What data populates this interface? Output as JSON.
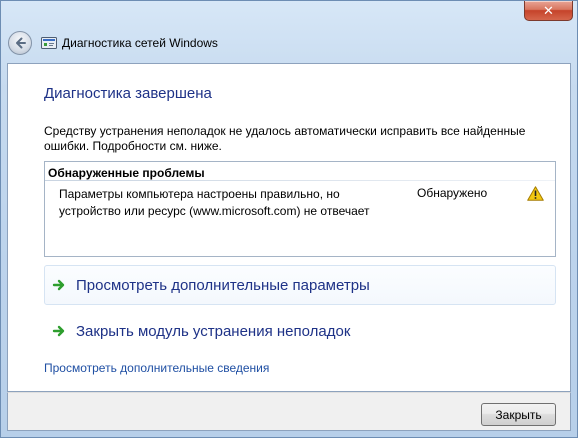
{
  "window": {
    "title": "Диагностика сетей Windows",
    "close_glyph": "✕"
  },
  "main": {
    "heading": "Диагностика завершена",
    "description": "Средству устранения неполадок не удалось автоматически исправить все найденные ошибки. Подробности см. ниже."
  },
  "problems": {
    "header": "Обнаруженные проблемы",
    "items": [
      {
        "text": "Параметры компьютера настроены правильно, но устройство или ресурс (www.microsoft.com) не отвечает",
        "status": "Обнаружено",
        "icon": "warning-icon"
      }
    ]
  },
  "actions": [
    {
      "label": "Просмотреть дополнительные параметры",
      "icon": "green-arrow-icon"
    },
    {
      "label": "Закрыть модуль устранения неполадок",
      "icon": "green-arrow-icon"
    }
  ],
  "details_link": "Просмотреть дополнительные сведения",
  "footer": {
    "close_button": "Закрыть"
  },
  "colors": {
    "heading": "#1e3287",
    "link": "#1f4fa3",
    "arrow": "#2e9e2e",
    "warning": "#f2c811"
  }
}
